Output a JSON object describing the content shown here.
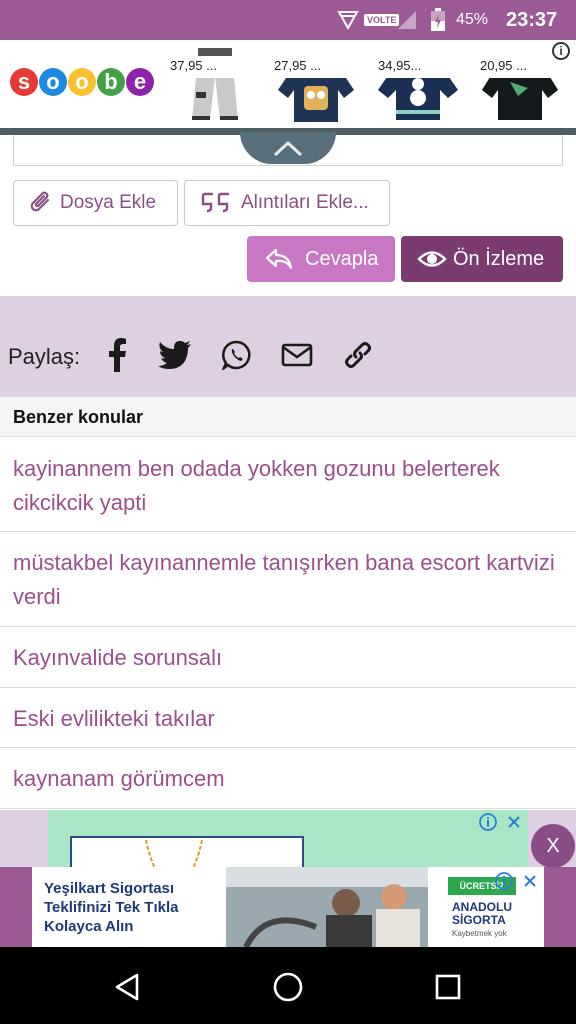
{
  "status_bar": {
    "volte": "VOLTE",
    "battery": "45%",
    "time": "23:37"
  },
  "top_ad": {
    "brand": "soobe",
    "logo_letters": [
      "s",
      "o",
      "o",
      "b",
      "e"
    ],
    "logo_colors": [
      "#e53935",
      "#1e88e5",
      "#fbc02d",
      "#43a047",
      "#8e24aa"
    ],
    "products": [
      {
        "price": "37,95 ..."
      },
      {
        "price": "27,95 ..."
      },
      {
        "price": "34,95..."
      },
      {
        "price": "20,95 ..."
      }
    ],
    "info_icon": "i"
  },
  "editor": {
    "attach_button": "Dosya Ekle",
    "quotes_button": "Alıntıları Ekle...",
    "reply_button": "Cevapla",
    "preview_button": "Ön İzleme"
  },
  "share": {
    "label": "Paylaş:",
    "icons": [
      "facebook-icon",
      "twitter-icon",
      "whatsapp-icon",
      "email-icon",
      "link-icon"
    ]
  },
  "similar": {
    "header": "Benzer konular",
    "items": [
      "kayinannem ben odada yokken gozunu belerterek cikcikcik yapti",
      "müstakbel kayınannemle tanışırken bana escort kartvizi verdi",
      "Kayınvalide sorunsalı",
      "Eski evlilikteki takılar",
      "kaynanam görümcem"
    ]
  },
  "ad": {
    "close_label": "X",
    "text": "Yeşilkart Sigortası Teklifinizi Tek Tıkla Kolayca Alın",
    "brand_line1": "ANADOLU",
    "brand_line2": "SİGORTA",
    "brand_badge": "ÜCRETSİZ",
    "brand_sub": "Kaybetmek yok"
  },
  "colors": {
    "accent": "#9b5a94",
    "link": "#9b4f8e",
    "reply_button": "#c777c4",
    "preview_button": "#7b3b6f",
    "share_bg": "#decfe2"
  }
}
